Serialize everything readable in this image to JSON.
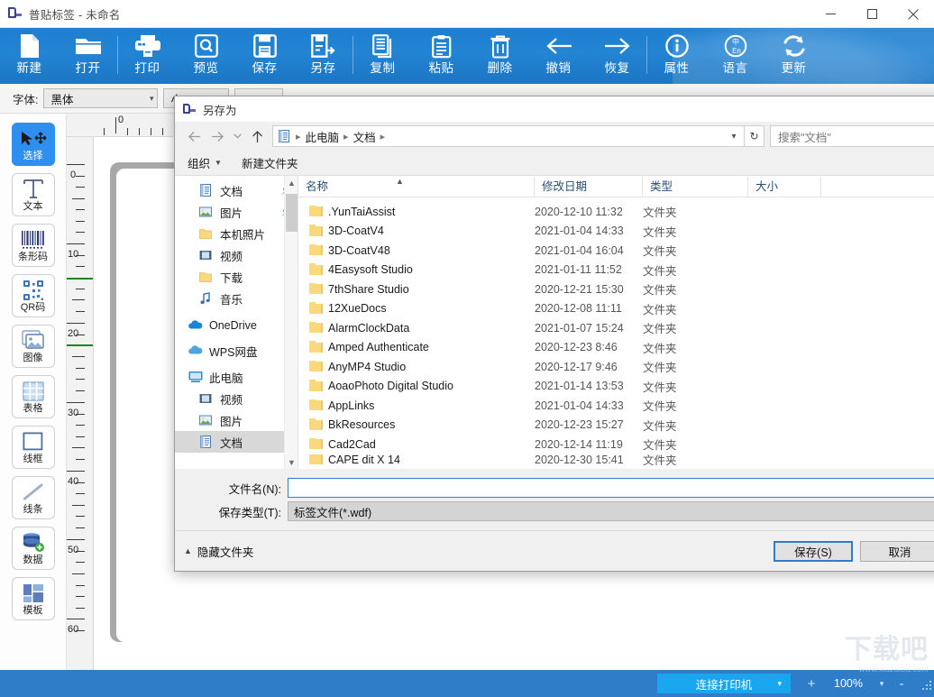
{
  "main_window": {
    "title": "普贴标签 - 未命名",
    "app_icon": "app-logo-icon",
    "window_controls": {
      "minimize": "minimize-icon",
      "maximize": "maximize-icon",
      "close": "close-icon"
    }
  },
  "ribbon": {
    "items": [
      {
        "label": "新建",
        "icon": "new-file-icon"
      },
      {
        "label": "打开",
        "icon": "open-folder-icon"
      },
      {
        "label": "打印",
        "icon": "printer-icon"
      },
      {
        "label": "预览",
        "icon": "preview-magnifier-icon"
      },
      {
        "label": "保存",
        "icon": "save-floppy-icon"
      },
      {
        "label": "另存",
        "icon": "save-as-icon"
      },
      {
        "label": "复制",
        "icon": "copy-icon"
      },
      {
        "label": "粘贴",
        "icon": "paste-icon"
      },
      {
        "label": "删除",
        "icon": "trash-icon"
      },
      {
        "label": "撤销",
        "icon": "undo-arrow-icon"
      },
      {
        "label": "恢复",
        "icon": "redo-arrow-icon"
      },
      {
        "label": "属性",
        "icon": "info-circle-icon"
      },
      {
        "label": "语言",
        "icon": "language-globe-icon"
      },
      {
        "label": "更新",
        "icon": "refresh-update-icon"
      }
    ]
  },
  "property_bar": {
    "font_label": "字体:",
    "font_value": "黑体",
    "size_value": "小",
    "caret": "chevron-down-icon"
  },
  "tool_palette": {
    "items": [
      {
        "label": "选择",
        "icon": "cursor-move-icon",
        "active": true
      },
      {
        "label": "文本",
        "icon": "text-t-icon",
        "active": false
      },
      {
        "label": "条形码",
        "icon": "barcode-icon",
        "active": false
      },
      {
        "label": "QR码",
        "icon": "qrcode-icon",
        "active": false
      },
      {
        "label": "图像",
        "icon": "image-icon",
        "active": false
      },
      {
        "label": "表格",
        "icon": "table-grid-icon",
        "active": false
      },
      {
        "label": "线框",
        "icon": "rectangle-icon",
        "active": false
      },
      {
        "label": "线条",
        "icon": "line-icon",
        "active": false
      },
      {
        "label": "数据",
        "icon": "database-add-icon",
        "active": false
      },
      {
        "label": "模板",
        "icon": "template-icon",
        "active": false
      }
    ]
  },
  "rulers": {
    "horizontal_labels": [
      "0"
    ],
    "vertical_labels": [
      "0",
      "10",
      "20",
      "30",
      "40",
      "50",
      "60"
    ],
    "unit": "mm"
  },
  "status_bar": {
    "printer_button": "连接打印机",
    "printer_caret": "chevron-down-icon",
    "zoom_in": "+",
    "zoom_value": "100%",
    "zoom_out": "-",
    "zoom_caret": "chevron-down-icon",
    "resize_grip": "resize-grip-icon"
  },
  "watermark": {
    "big": "下载吧",
    "small": "www.xiazaiba.com"
  },
  "dialog": {
    "title": "另存为",
    "icon": "app-logo-icon",
    "nav": {
      "back": "back-arrow-icon",
      "forward": "forward-arrow-icon",
      "recent": "chevron-down-icon",
      "up": "up-arrow-icon",
      "breadcrumb_icon": "documents-icon",
      "breadcrumb": [
        "此电脑",
        "文档"
      ],
      "breadcrumb_caret": "chevron-down-icon",
      "refresh": "refresh-icon",
      "search_placeholder": "搜索\"文档\""
    },
    "commands": [
      {
        "label": "组织",
        "has_caret": true
      },
      {
        "label": "新建文件夹",
        "has_caret": false
      }
    ],
    "sidebar": [
      {
        "label": "文档",
        "icon": "documents-icon",
        "pinned": true,
        "selected": false
      },
      {
        "label": "图片",
        "icon": "pictures-icon",
        "pinned": true,
        "selected": false
      },
      {
        "label": "本机照片",
        "icon": "folder-icon",
        "pinned": false,
        "selected": false
      },
      {
        "label": "视频",
        "icon": "videos-icon",
        "pinned": false,
        "selected": false
      },
      {
        "label": "下载",
        "icon": "folder-icon",
        "pinned": false,
        "selected": false
      },
      {
        "label": "音乐",
        "icon": "music-note-icon",
        "pinned": false,
        "selected": false
      },
      {
        "label": "OneDrive",
        "icon": "onedrive-cloud-icon",
        "pinned": false,
        "selected": false
      },
      {
        "label": "WPS网盘",
        "icon": "wps-cloud-icon",
        "pinned": false,
        "selected": false
      },
      {
        "label": "此电脑",
        "icon": "this-pc-icon",
        "pinned": false,
        "selected": false
      },
      {
        "label": "视频",
        "icon": "videos-icon",
        "pinned": false,
        "selected": false
      },
      {
        "label": "图片",
        "icon": "pictures-icon",
        "pinned": false,
        "selected": false
      },
      {
        "label": "文档",
        "icon": "documents-icon",
        "pinned": false,
        "selected": true
      }
    ],
    "columns": [
      "名称",
      "修改日期",
      "类型",
      "大小"
    ],
    "sort_indicator": "sort-ascending-icon",
    "files": [
      {
        "name": ".YunTaiAssist",
        "date": "2020-12-10 11:32",
        "type": "文件夹",
        "size": ""
      },
      {
        "name": "3D-CoatV4",
        "date": "2021-01-04 14:33",
        "type": "文件夹",
        "size": ""
      },
      {
        "name": "3D-CoatV48",
        "date": "2021-01-04 16:04",
        "type": "文件夹",
        "size": ""
      },
      {
        "name": "4Easysoft Studio",
        "date": "2021-01-11 11:52",
        "type": "文件夹",
        "size": ""
      },
      {
        "name": "7thShare Studio",
        "date": "2020-12-21 15:30",
        "type": "文件夹",
        "size": ""
      },
      {
        "name": "12XueDocs",
        "date": "2020-12-08 11:11",
        "type": "文件夹",
        "size": ""
      },
      {
        "name": "AlarmClockData",
        "date": "2021-01-07 15:24",
        "type": "文件夹",
        "size": ""
      },
      {
        "name": "Amped Authenticate",
        "date": "2020-12-23 8:46",
        "type": "文件夹",
        "size": ""
      },
      {
        "name": "AnyMP4 Studio",
        "date": "2020-12-17 9:46",
        "type": "文件夹",
        "size": ""
      },
      {
        "name": "AoaoPhoto Digital Studio",
        "date": "2021-01-14 13:53",
        "type": "文件夹",
        "size": ""
      },
      {
        "name": "AppLinks",
        "date": "2021-01-04 14:33",
        "type": "文件夹",
        "size": ""
      },
      {
        "name": "BkResources",
        "date": "2020-12-23 15:27",
        "type": "文件夹",
        "size": ""
      },
      {
        "name": "Cad2Cad",
        "date": "2020-12-14 11:19",
        "type": "文件夹",
        "size": ""
      },
      {
        "name": "CAPE dit  X 14",
        "date": "2020-12-30 15:41",
        "type": "文件夹",
        "size": ""
      }
    ],
    "filename_label": "文件名(N):",
    "filename_value": "",
    "filetype_label": "保存类型(T):",
    "filetype_value": "标签文件(*.wdf)",
    "hide_folders_label": "隐藏文件夹",
    "hide_folders_caret": "chevron-up-icon",
    "save_button": "保存(S)",
    "cancel_button": "取消"
  }
}
